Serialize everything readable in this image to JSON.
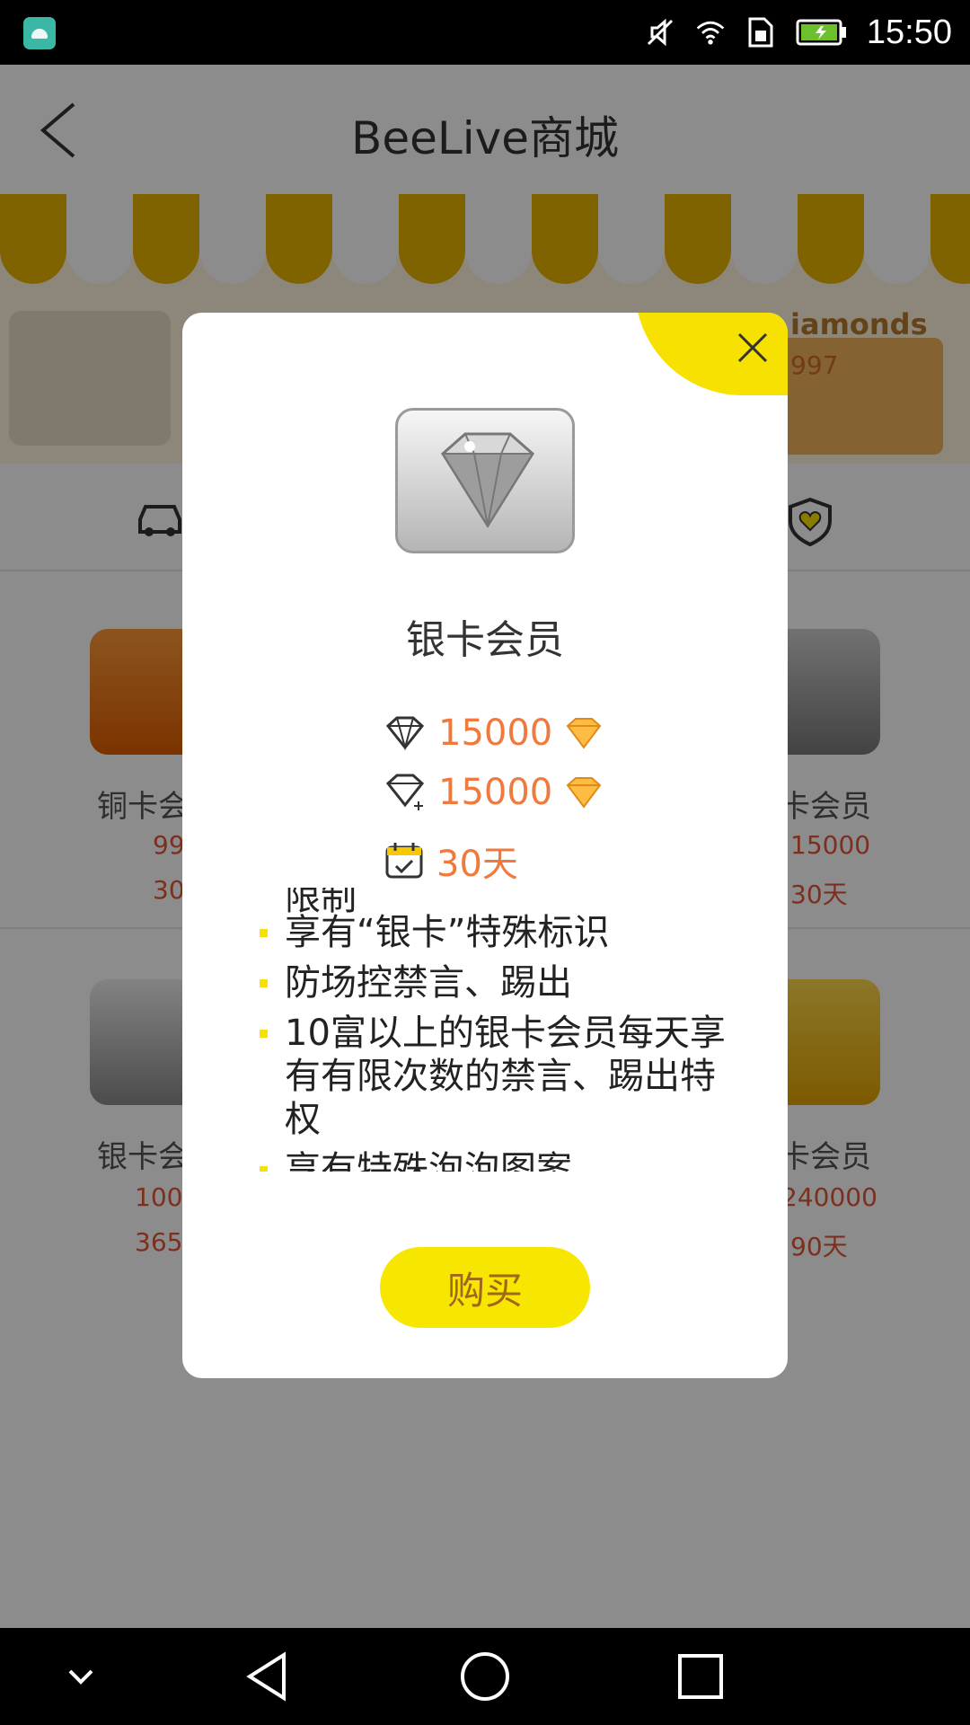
{
  "status_bar": {
    "time": "15:50"
  },
  "header": {
    "title": "BeeLive商城"
  },
  "banner": {
    "right_text": "iamonds",
    "right_number": "997"
  },
  "grid": {
    "left_col": [
      {
        "label": "铜卡会",
        "line1": "99",
        "line2": "30"
      },
      {
        "label": "银卡会",
        "line1": "100",
        "line2": "365"
      }
    ],
    "right_col": [
      {
        "label": "卡会员",
        "line1": "15000",
        "line2": "30天"
      },
      {
        "label": "卡会员",
        "line1": "240000",
        "line2": "90天"
      }
    ]
  },
  "dialog": {
    "title": "银卡会员",
    "price_diamond": "15000",
    "price_diamond_plus": "15000",
    "duration": "30天",
    "desc_cutoff": "限制",
    "desc_items": [
      "享有“银卡”特殊标识",
      "防场控禁言、踢出",
      "10富以上的银卡会员每天享有有限次数的禁言、踢出特权",
      "享有特殊泡泡图案"
    ],
    "buy_label": "购买"
  },
  "colors": {
    "accent_yellow": "#F7E600",
    "price_orange": "#F07A3E",
    "dialog_bg": "#FFFFFF"
  }
}
